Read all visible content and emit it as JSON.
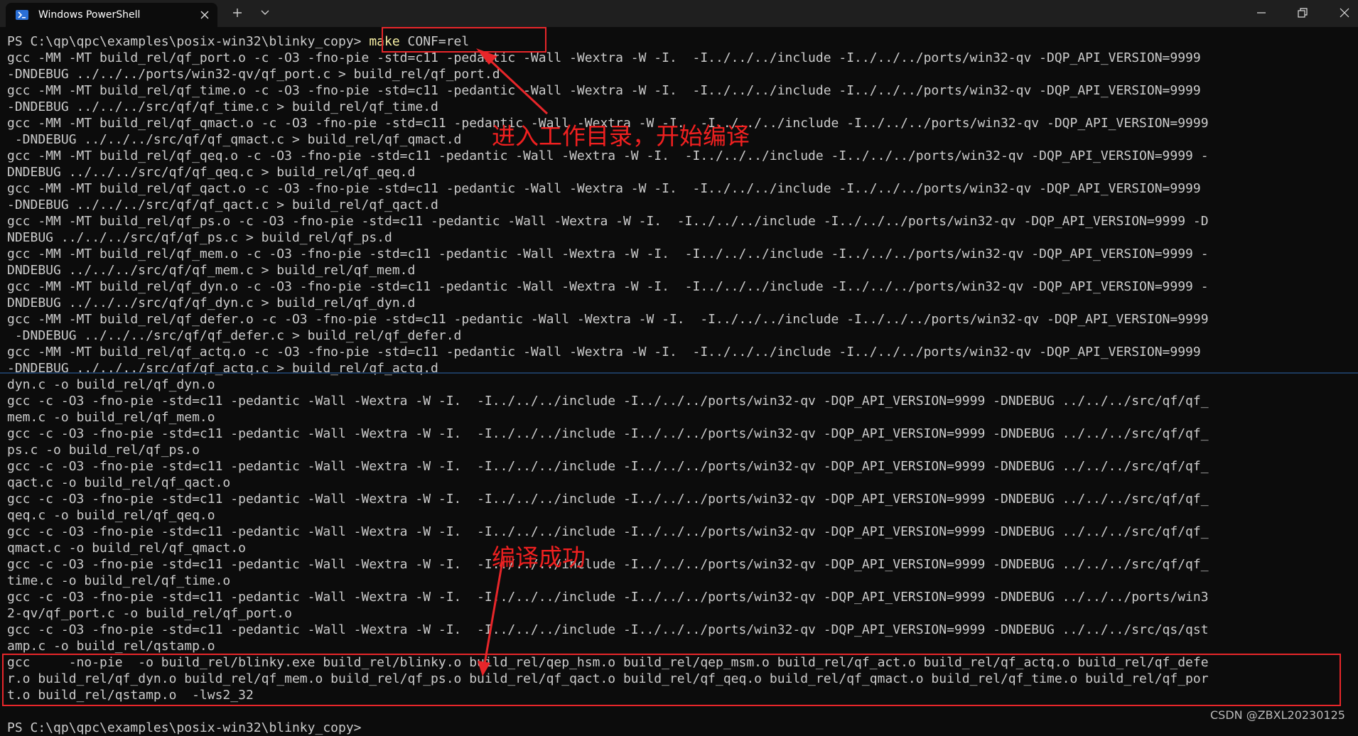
{
  "window": {
    "tab_title": "Windows PowerShell",
    "icons": {
      "tab": "powershell-icon",
      "close_tab": "close-icon",
      "new_tab": "plus-icon",
      "dropdown": "chevron-down-icon",
      "minimize": "minimize-icon",
      "restore": "restore-icon",
      "close_window": "close-icon"
    }
  },
  "terminal": {
    "prompt": "PS C:\\qp\\qpc\\examples\\posix-win32\\blinky_copy>",
    "command_keyword": "make",
    "command_args": " CONF=rel",
    "lines": [
      "gcc -MM -MT build_rel/qf_port.o -c -O3 -fno-pie -std=c11 -pedantic -Wall -Wextra -W -I.  -I../../../include -I../../../ports/win32-qv -DQP_API_VERSION=9999",
      "-DNDEBUG ../../../ports/win32-qv/qf_port.c > build_rel/qf_port.d",
      "gcc -MM -MT build_rel/qf_time.o -c -O3 -fno-pie -std=c11 -pedantic -Wall -Wextra -W -I.  -I../../../include -I../../../ports/win32-qv -DQP_API_VERSION=9999",
      "-DNDEBUG ../../../src/qf/qf_time.c > build_rel/qf_time.d",
      "gcc -MM -MT build_rel/qf_qmact.o -c -O3 -fno-pie -std=c11 -pedantic -Wall -Wextra -W -I.  -I../../../include -I../../../ports/win32-qv -DQP_API_VERSION=9999",
      " -DNDEBUG ../../../src/qf/qf_qmact.c > build_rel/qf_qmact.d",
      "gcc -MM -MT build_rel/qf_qeq.o -c -O3 -fno-pie -std=c11 -pedantic -Wall -Wextra -W -I.  -I../../../include -I../../../ports/win32-qv -DQP_API_VERSION=9999 -",
      "DNDEBUG ../../../src/qf/qf_qeq.c > build_rel/qf_qeq.d",
      "gcc -MM -MT build_rel/qf_qact.o -c -O3 -fno-pie -std=c11 -pedantic -Wall -Wextra -W -I.  -I../../../include -I../../../ports/win32-qv -DQP_API_VERSION=9999",
      "-DNDEBUG ../../../src/qf/qf_qact.c > build_rel/qf_qact.d",
      "gcc -MM -MT build_rel/qf_ps.o -c -O3 -fno-pie -std=c11 -pedantic -Wall -Wextra -W -I.  -I../../../include -I../../../ports/win32-qv -DQP_API_VERSION=9999 -D",
      "NDEBUG ../../../src/qf/qf_ps.c > build_rel/qf_ps.d",
      "gcc -MM -MT build_rel/qf_mem.o -c -O3 -fno-pie -std=c11 -pedantic -Wall -Wextra -W -I.  -I../../../include -I../../../ports/win32-qv -DQP_API_VERSION=9999 -",
      "DNDEBUG ../../../src/qf/qf_mem.c > build_rel/qf_mem.d",
      "gcc -MM -MT build_rel/qf_dyn.o -c -O3 -fno-pie -std=c11 -pedantic -Wall -Wextra -W -I.  -I../../../include -I../../../ports/win32-qv -DQP_API_VERSION=9999 -",
      "DNDEBUG ../../../src/qf/qf_dyn.c > build_rel/qf_dyn.d",
      "gcc -MM -MT build_rel/qf_defer.o -c -O3 -fno-pie -std=c11 -pedantic -Wall -Wextra -W -I.  -I../../../include -I../../../ports/win32-qv -DQP_API_VERSION=9999",
      " -DNDEBUG ../../../src/qf/qf_defer.c > build_rel/qf_defer.d",
      "gcc -MM -MT build_rel/qf_actq.o -c -O3 -fno-pie -std=c11 -pedantic -Wall -Wextra -W -I.  -I../../../include -I../../../ports/win32-qv -DQP_API_VERSION=9999",
      "-DNDEBUG ../../../src/qf/qf_actq.c > build_rel/qf_actq.d",
      "dyn.c -o build_rel/qf_dyn.o",
      "gcc -c -O3 -fno-pie -std=c11 -pedantic -Wall -Wextra -W -I.  -I../../../include -I../../../ports/win32-qv -DQP_API_VERSION=9999 -DNDEBUG ../../../src/qf/qf_",
      "mem.c -o build_rel/qf_mem.o",
      "gcc -c -O3 -fno-pie -std=c11 -pedantic -Wall -Wextra -W -I.  -I../../../include -I../../../ports/win32-qv -DQP_API_VERSION=9999 -DNDEBUG ../../../src/qf/qf_",
      "ps.c -o build_rel/qf_ps.o",
      "gcc -c -O3 -fno-pie -std=c11 -pedantic -Wall -Wextra -W -I.  -I../../../include -I../../../ports/win32-qv -DQP_API_VERSION=9999 -DNDEBUG ../../../src/qf/qf_",
      "qact.c -o build_rel/qf_qact.o",
      "gcc -c -O3 -fno-pie -std=c11 -pedantic -Wall -Wextra -W -I.  -I../../../include -I../../../ports/win32-qv -DQP_API_VERSION=9999 -DNDEBUG ../../../src/qf/qf_",
      "qeq.c -o build_rel/qf_qeq.o",
      "gcc -c -O3 -fno-pie -std=c11 -pedantic -Wall -Wextra -W -I.  -I../../../include -I../../../ports/win32-qv -DQP_API_VERSION=9999 -DNDEBUG ../../../src/qf/qf_",
      "qmact.c -o build_rel/qf_qmact.o",
      "gcc -c -O3 -fno-pie -std=c11 -pedantic -Wall -Wextra -W -I.  -I../../../include -I../../../ports/win32-qv -DQP_API_VERSION=9999 -DNDEBUG ../../../src/qf/qf_",
      "time.c -o build_rel/qf_time.o",
      "gcc -c -O3 -fno-pie -std=c11 -pedantic -Wall -Wextra -W -I.  -I../../../include -I../../../ports/win32-qv -DQP_API_VERSION=9999 -DNDEBUG ../../../ports/win3",
      "2-qv/qf_port.c -o build_rel/qf_port.o",
      "gcc -c -O3 -fno-pie -std=c11 -pedantic -Wall -Wextra -W -I.  -I../../../include -I../../../ports/win32-qv -DQP_API_VERSION=9999 -DNDEBUG ../../../src/qs/qst",
      "amp.c -o build_rel/qstamp.o",
      "gcc     -no-pie  -o build_rel/blinky.exe build_rel/blinky.o build_rel/qep_hsm.o build_rel/qep_msm.o build_rel/qf_act.o build_rel/qf_actq.o build_rel/qf_defe",
      "r.o build_rel/qf_dyn.o build_rel/qf_mem.o build_rel/qf_ps.o build_rel/qf_qact.o build_rel/qf_qeq.o build_rel/qf_qmact.o build_rel/qf_time.o build_rel/qf_por",
      "t.o build_rel/qstamp.o  -lws2_32"
    ],
    "final_prompt": "PS C:\\qp\\qpc\\examples\\posix-win32\\blinky_copy>"
  },
  "annotations": {
    "enter_dir": "进入工作目录，开始编译",
    "success": "编译成功",
    "color": "#e8262a"
  },
  "watermark": "CSDN @ZBXL20230125"
}
